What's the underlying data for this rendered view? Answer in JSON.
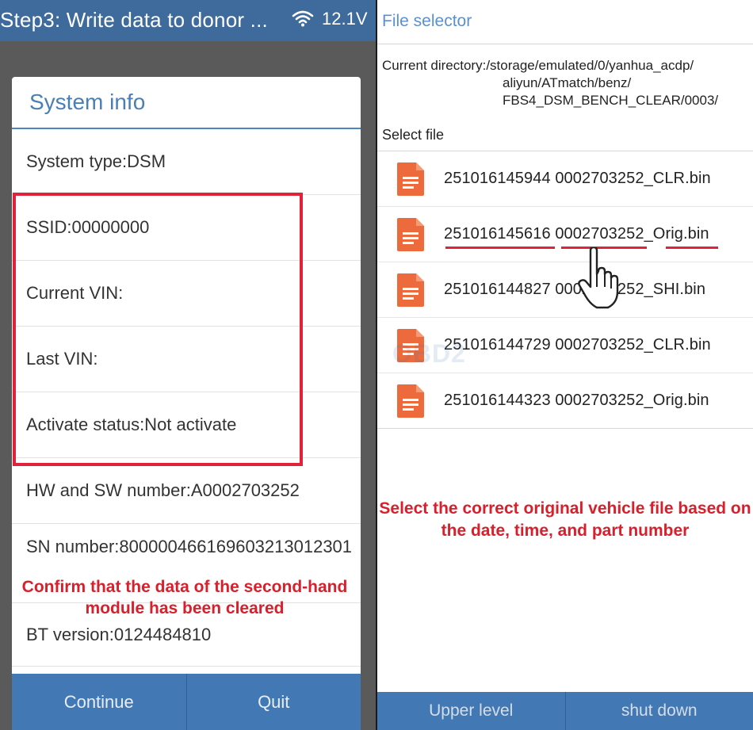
{
  "left": {
    "status_title": "Step3: Write data to donor ...",
    "voltage": "12.1V",
    "dialog": {
      "title": "System info",
      "rows": [
        "System type:DSM",
        "SSID:00000000",
        "Current VIN:",
        "Last VIN:",
        "Activate status:Not activate",
        "HW and SW number:A0002703252",
        "SN number:800000466169603213012301",
        "BT version:0124484810"
      ]
    },
    "annotation": "Confirm that the data of the second-hand module has been cleared",
    "buttons": {
      "continue": "Continue",
      "quit": "Quit"
    }
  },
  "right": {
    "title": "File selector",
    "directory": {
      "line1": "Current directory:/storage/emulated/0/yanhua_acdp/",
      "line2": "aliyun/ATmatch/benz/",
      "line3": "FBS4_DSM_BENCH_CLEAR/0003/"
    },
    "select_label": "Select file",
    "files": [
      "251016145944 0002703252_CLR.bin",
      "251016145616 0002703252_Orig.bin",
      "251016144827 0002703252_SHI.bin",
      "251016144729 0002703252_CLR.bin",
      "251016144323 0002703252_Orig.bin"
    ],
    "annotation": "Select the correct original vehicle file based on the date, time, and part number",
    "buttons": {
      "upper_level": "Upper level",
      "shut_down": "shut down"
    },
    "watermark": "OBD2"
  },
  "colors": {
    "accent_blue": "#4279b5",
    "status_bar": "#3e6b9c",
    "annotation_red": "#d8202c",
    "file_icon_orange": "#ec6a3c"
  },
  "icons": {
    "wifi": "wifi-icon",
    "file": "document-icon",
    "pointer": "hand-pointer-icon"
  }
}
